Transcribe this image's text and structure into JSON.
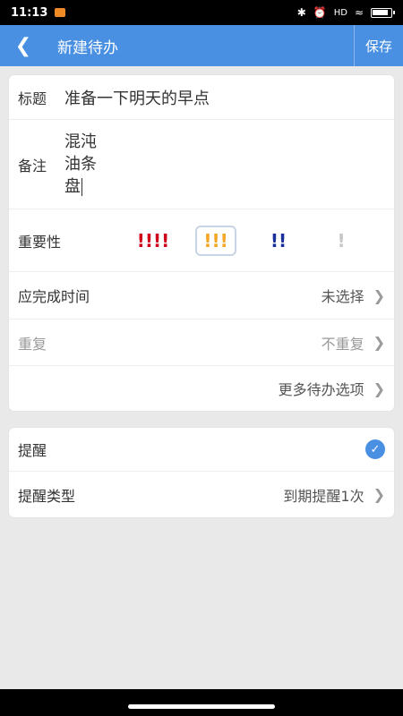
{
  "status_bar": {
    "time": "11:13",
    "signal_text": "HD",
    "icons": [
      "bluetooth-icon",
      "alarm-icon",
      "signal-icon",
      "wifi-icon",
      "battery-icon"
    ]
  },
  "header": {
    "back_icon": "chevron-left-icon",
    "title": "新建待办",
    "save_label": "保存"
  },
  "form": {
    "title_label": "标题",
    "title_value": "准备一下明天的早点",
    "note_label": "备注",
    "note_lines": [
      "混沌",
      "油条",
      "盘"
    ],
    "importance_label": "重要性",
    "importance_options": [
      {
        "text": "!!!!",
        "color": "#d0021b"
      },
      {
        "text": "!!!",
        "color": "#f5a623",
        "selected": true
      },
      {
        "text": "!!",
        "color": "#1b2f9c"
      },
      {
        "text": "!",
        "color": "#c8c8c8"
      }
    ],
    "due_label": "应完成时间",
    "due_value": "未选择",
    "repeat_label": "重复",
    "repeat_value": "不重复",
    "more_options_label": "更多待办选项"
  },
  "reminder": {
    "label": "提醒",
    "enabled": true,
    "type_label": "提醒类型",
    "type_value": "到期提醒1次"
  },
  "colors": {
    "accent": "#4a90e2",
    "background": "#e9e9e9"
  }
}
